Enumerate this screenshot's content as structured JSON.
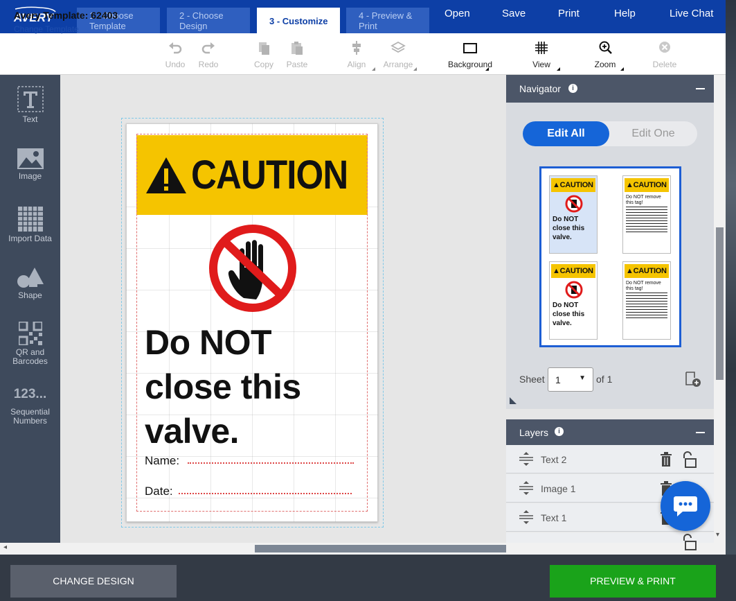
{
  "brand": {
    "logo_text": "AVERY",
    "accent": "#0d3fa6"
  },
  "steps": [
    {
      "label_line1": "1 - Choose",
      "label_line2": "Template"
    },
    {
      "label_line1": "2 - Choose",
      "label_line2": "Design"
    },
    {
      "label_line1": "3 - Customize",
      "label_line2": ""
    },
    {
      "label_line1": "4 - Preview &",
      "label_line2": "Print"
    }
  ],
  "top_menu": {
    "open": "Open",
    "save": "Save",
    "print": "Print",
    "help": "Help",
    "live_chat": "Live Chat"
  },
  "template": {
    "title": "Avery Template: 62403",
    "change_link": "Change Template"
  },
  "toolbar": {
    "undo": "Undo",
    "redo": "Redo",
    "copy": "Copy",
    "paste": "Paste",
    "align": "Align",
    "arrange": "Arrange",
    "background": "Background",
    "view": "View",
    "zoom": "Zoom",
    "delete": "Delete"
  },
  "sidebar": {
    "text": "Text",
    "image": "Image",
    "import_data": "Import Data",
    "shape": "Shape",
    "qr_line1": "QR and",
    "qr_line2": "Barcodes",
    "seq_glyph": "123...",
    "seq_line1": "Sequential",
    "seq_line2": "Numbers"
  },
  "label": {
    "caution": "CAUTION",
    "line1": "Do NOT",
    "line2": "close this",
    "line3": "valve.",
    "name_label": "Name:",
    "date_label": "Date:",
    "caution_color": "#f5c400",
    "stop_color": "#e01b1b"
  },
  "navigator": {
    "title": "Navigator",
    "edit_all": "Edit All",
    "edit_one": "Edit One",
    "mini_caution": "CAUTION",
    "mini_valve_1": "Do NOT",
    "mini_valve_2": "close this",
    "mini_valve_3": "valve.",
    "mini_tag_1": "Do NOT remove",
    "mini_tag_2": "this tag!",
    "sheet_label": "Sheet",
    "sheet_value": "1",
    "sheet_of": "of 1"
  },
  "layers": {
    "title": "Layers",
    "items": [
      "Text 2",
      "Image 1",
      "Text 1"
    ]
  },
  "bottom": {
    "change_design": "CHANGE DESIGN",
    "preview_print": "PREVIEW & PRINT"
  }
}
